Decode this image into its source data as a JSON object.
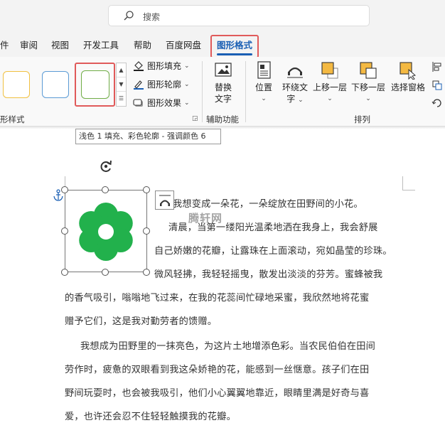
{
  "search": {
    "placeholder": "搜索"
  },
  "tabs": [
    {
      "label": "件"
    },
    {
      "label": "审阅"
    },
    {
      "label": "视图"
    },
    {
      "label": "开发工具"
    },
    {
      "label": "帮助"
    },
    {
      "label": "百度网盘"
    },
    {
      "label": "图形格式",
      "active": true
    }
  ],
  "ribbon": {
    "shape_styles": {
      "group_label": "形样式",
      "fill_label": "图形填充",
      "outline_label": "图形轮廓",
      "effects_label": "图形效果",
      "swatch_colors": [
        "#f0c040",
        "#5b9bd5",
        "#70ad47"
      ]
    },
    "accessibility": {
      "alt_text_label_1": "替换",
      "alt_text_label_2": "文字",
      "group_label": "辅助功能"
    },
    "arrange": {
      "position_label": "位置",
      "wrap_label_1": "环绕文",
      "wrap_label_2": "字",
      "bring_forward_label": "上移一层",
      "send_backward_label": "下移一层",
      "selection_pane_label": "选择窗格",
      "group_label": "排列"
    }
  },
  "tooltip": {
    "text": "浅色 1 填充、彩色轮廓 - 强调颜色 6"
  },
  "document": {
    "watermark": "腾轩网",
    "lines": [
      "我想变成一朵花，一朵绽放在田野间的小花。",
      "清晨，当第一缕阳光温柔地洒在我身上，我会舒展",
      "自己娇嫩的花瓣，让露珠在上面滚动，宛如晶莹的珍珠。",
      "微风轻拂，我轻轻摇曳，散发出淡淡的芬芳。蜜蜂被我",
      "的香气吸引，嗡嗡地飞过来，在我的花蕊间忙碌地采蜜，我欣然地将花蜜",
      "赠予它们，这是我对勤劳者的馈赠。",
      "我想成为田野里的一抹亮色，为这片土地增添色彩。当农民伯伯在田间",
      "劳作时，疲惫的双眼看到我这朵娇艳的花，能感到一丝惬意。孩子们在田",
      "野间玩耍时，也会被我吸引，他们小心翼翼地靠近，眼睛里满是好奇与喜",
      "爱，也许还会忍不住轻轻触摸我的花瓣。"
    ],
    "flower_color": "#22b14c"
  },
  "colors": {
    "accent": "#1a5fb4",
    "highlight": "#e05a5a"
  }
}
